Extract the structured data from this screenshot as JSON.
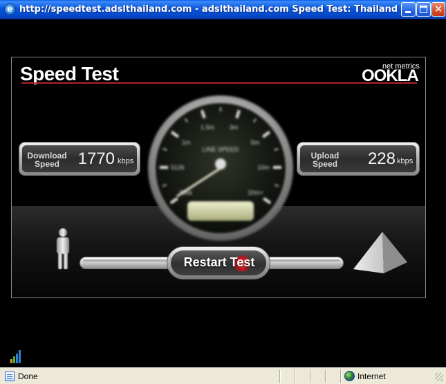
{
  "window": {
    "title": "http://speedtest.adslthailand.com - adslthailand.com Speed Test: Thailand's most pre...",
    "app_icon": "ie-icon",
    "controls": [
      "minimize-icon",
      "maximize-icon",
      "close-icon"
    ],
    "close_glyph": "✕"
  },
  "speedtest": {
    "title": "Speed Test",
    "brand_small": "net metrics",
    "brand": "OOKLA",
    "download": {
      "label_line1": "Download",
      "label_line2": "Speed",
      "value": "1770",
      "unit": "kbps"
    },
    "upload": {
      "label_line1": "Upload",
      "label_line2": "Speed",
      "value": "228",
      "unit": "kbps"
    },
    "gauge": {
      "label": "LINE SPEED",
      "ticks": [
        "256k",
        "512k",
        "1m",
        "1.5m",
        "3m",
        "5m",
        "10m",
        "20m+"
      ]
    },
    "restart_label": "Restart Test",
    "colors": {
      "accent_rule": "#b0232a",
      "restart_glow": "#d11a22"
    }
  },
  "statusbar": {
    "status": "Done",
    "zone": "Internet"
  }
}
